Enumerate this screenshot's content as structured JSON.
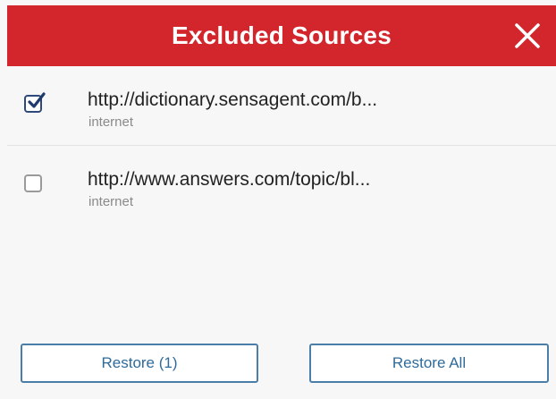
{
  "header": {
    "title": "Excluded Sources",
    "close_icon": "close-icon",
    "background_color": "#d2262c"
  },
  "sources": [
    {
      "url": "http://dictionary.sensagent.com/b...",
      "type": "internet",
      "checked": true
    },
    {
      "url": "http://www.answers.com/topic/bl...",
      "type": "internet",
      "checked": false
    }
  ],
  "actions": {
    "restore_selected_label": "Restore (1)",
    "restore_all_label": "Restore All",
    "accent_color": "#2e6a9a"
  }
}
